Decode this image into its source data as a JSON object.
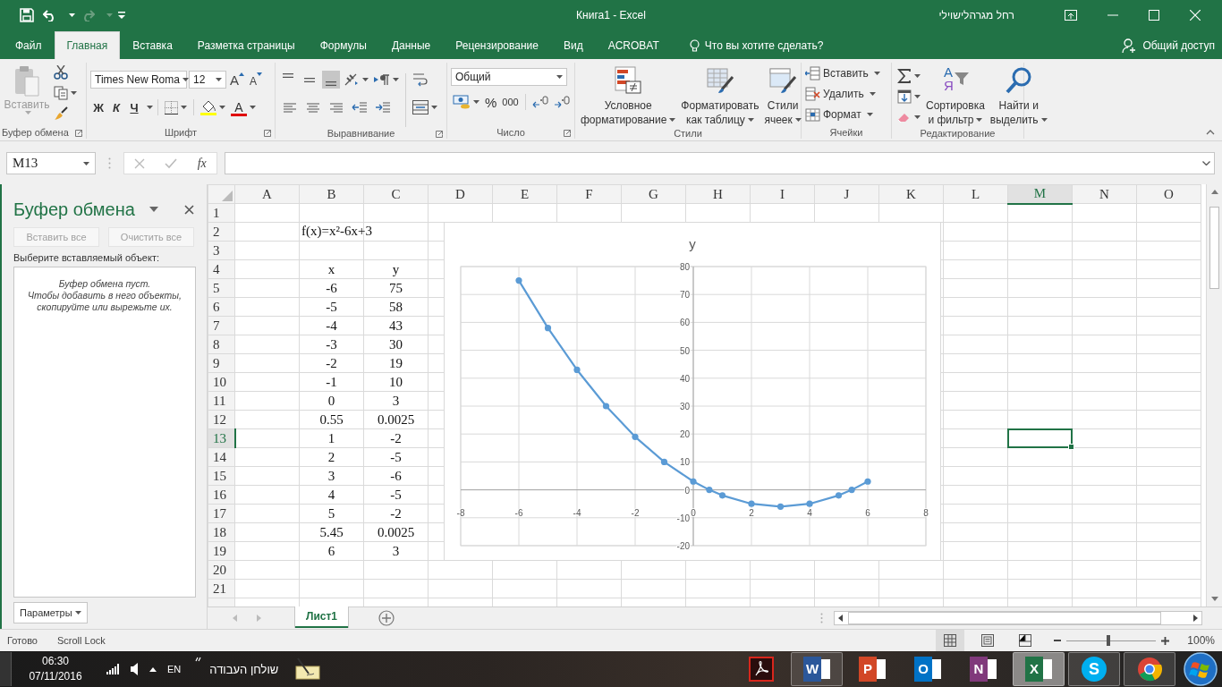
{
  "title_bar": {
    "document_title": "Книга1 - Excel",
    "user_name": "רחל מגרהלישוילי"
  },
  "ribbon_tabs": [
    {
      "label": "Файл",
      "selected": false
    },
    {
      "label": "Главная",
      "selected": true
    },
    {
      "label": "Вставка",
      "selected": false
    },
    {
      "label": "Разметка страницы",
      "selected": false
    },
    {
      "label": "Формулы",
      "selected": false
    },
    {
      "label": "Данные",
      "selected": false
    },
    {
      "label": "Рецензирование",
      "selected": false
    },
    {
      "label": "Вид",
      "selected": false
    },
    {
      "label": "ACROBAT",
      "selected": false
    }
  ],
  "tell_me": "Что вы хотите сделать?",
  "share": "Общий доступ",
  "ribbon": {
    "clipboard": {
      "label": "Буфер обмена",
      "paste": "Вставить",
      "paste_disabled": true
    },
    "font": {
      "label": "Шрифт",
      "font_name": "Times New Roma",
      "font_size": "12",
      "grow": "A",
      "shrink": "A",
      "bold": "Ж",
      "italic": "К",
      "underline": "Ч",
      "font_color": "A"
    },
    "alignment": {
      "label": "Выравнивание",
      "vertical_align": [
        {
          "selected": false
        },
        {
          "selected": false
        },
        {
          "selected": true
        }
      ]
    },
    "number": {
      "label": "Число",
      "format": "Общий",
      "percent": "%",
      "thousands": "000"
    },
    "styles": {
      "label": "Стили",
      "buttons": [
        {
          "kind": "conditional",
          "lines": [
            "Условное",
            "форматирование"
          ]
        },
        {
          "kind": "table",
          "lines": [
            "Форматировать",
            "как таблицу"
          ]
        },
        {
          "kind": "cell_styles",
          "lines": [
            "Стили",
            "ячеек"
          ]
        }
      ]
    },
    "cells": {
      "label": "Ячейки",
      "buttons": [
        {
          "kind": "insert",
          "label": "Вставить"
        },
        {
          "kind": "delete",
          "label": "Удалить"
        },
        {
          "kind": "format",
          "label": "Формат"
        }
      ]
    },
    "editing": {
      "label": "Редактирование",
      "sort_letters": [
        "А",
        "Я"
      ],
      "buttons": [
        {
          "kind": "sort",
          "lines": [
            "Сортировка",
            "и фильтр"
          ]
        },
        {
          "kind": "find",
          "lines": [
            "Найти и",
            "выделить"
          ]
        }
      ]
    }
  },
  "formula_bar": {
    "name_box": "M13",
    "function_label": "fx"
  },
  "clipboard_pane": {
    "title": "Буфер обмена",
    "buttons": [
      {
        "label": "Вставить все",
        "disabled": true
      },
      {
        "label": "Очистить все",
        "disabled": true
      }
    ],
    "prompt": "Выберите вставляемый объект:",
    "empty_message": [
      "Буфер обмена пуст.",
      "Чтобы добавить в него объекты,",
      "скопируйте или вырежьте их."
    ],
    "options": "Параметры"
  },
  "sheet": {
    "columns": [
      {
        "label": "A",
        "selected": false
      },
      {
        "label": "B",
        "selected": false
      },
      {
        "label": "C",
        "selected": false
      },
      {
        "label": "D",
        "selected": false
      },
      {
        "label": "E",
        "selected": false
      },
      {
        "label": "F",
        "selected": false
      },
      {
        "label": "G",
        "selected": false
      },
      {
        "label": "H",
        "selected": false
      },
      {
        "label": "I",
        "selected": false
      },
      {
        "label": "J",
        "selected": false
      },
      {
        "label": "K",
        "selected": false
      },
      {
        "label": "L",
        "selected": false
      },
      {
        "label": "M",
        "selected": true
      },
      {
        "label": "N",
        "selected": false
      },
      {
        "label": "O",
        "selected": false
      }
    ],
    "rows": [
      {
        "label": "1",
        "selected": false
      },
      {
        "label": "2",
        "selected": false,
        "kind": "formula",
        "cells": {
          "B": "f(x)=x²-6x+3"
        }
      },
      {
        "label": "3",
        "selected": false
      },
      {
        "label": "4",
        "selected": false,
        "kind": "data",
        "cells": {
          "B": "x",
          "C": "y"
        }
      },
      {
        "label": "5",
        "selected": false,
        "kind": "data",
        "cells": {
          "B": "-6",
          "C": "75"
        }
      },
      {
        "label": "6",
        "selected": false,
        "kind": "data",
        "cells": {
          "B": "-5",
          "C": "58"
        }
      },
      {
        "label": "7",
        "selected": false,
        "kind": "data",
        "cells": {
          "B": "-4",
          "C": "43"
        }
      },
      {
        "label": "8",
        "selected": false,
        "kind": "data",
        "cells": {
          "B": "-3",
          "C": "30"
        }
      },
      {
        "label": "9",
        "selected": false,
        "kind": "data",
        "cells": {
          "B": "-2",
          "C": "19"
        }
      },
      {
        "label": "10",
        "selected": false,
        "kind": "data",
        "cells": {
          "B": "-1",
          "C": "10"
        }
      },
      {
        "label": "11",
        "selected": false,
        "kind": "data",
        "cells": {
          "B": "0",
          "C": "3"
        }
      },
      {
        "label": "12",
        "selected": false,
        "kind": "data",
        "cells": {
          "B": "0.55",
          "C": "0.0025"
        }
      },
      {
        "label": "13",
        "selected": true,
        "kind": "data",
        "cells": {
          "B": "1",
          "C": "-2"
        }
      },
      {
        "label": "14",
        "selected": false,
        "kind": "data",
        "cells": {
          "B": "2",
          "C": "-5"
        }
      },
      {
        "label": "15",
        "selected": false,
        "kind": "data",
        "cells": {
          "B": "3",
          "C": "-6"
        }
      },
      {
        "label": "16",
        "selected": false,
        "kind": "data",
        "cells": {
          "B": "4",
          "C": "-5"
        }
      },
      {
        "label": "17",
        "selected": false,
        "kind": "data",
        "cells": {
          "B": "5",
          "C": "-2"
        }
      },
      {
        "label": "18",
        "selected": false,
        "kind": "data",
        "cells": {
          "B": "5.45",
          "C": "0.0025"
        }
      },
      {
        "label": "19",
        "selected": false,
        "kind": "data",
        "cells": {
          "B": "6",
          "C": "3"
        }
      },
      {
        "label": "20",
        "selected": false
      },
      {
        "label": "21",
        "selected": false
      }
    ]
  },
  "chart": {
    "chart_data": {
      "type": "line",
      "grid": true,
      "xlim": [
        -8,
        8
      ],
      "ylim": [
        -20,
        80
      ],
      "xticks": [
        -8,
        -6,
        -4,
        -2,
        0,
        2,
        4,
        6,
        8
      ],
      "yticks": [
        -20,
        -10,
        0,
        10,
        20,
        30,
        40,
        50,
        60,
        70,
        80
      ],
      "x": [
        -6,
        -5,
        -4,
        -3,
        -2,
        -1,
        0,
        0.55,
        1,
        2,
        3,
        4,
        5,
        5.45,
        6
      ],
      "series": [
        {
          "name": "y",
          "color": "#5b9bd5",
          "marker": true,
          "values": [
            75,
            58,
            43,
            30,
            19,
            10,
            3,
            0,
            -2,
            -5,
            -6,
            -5,
            -2,
            0,
            3
          ]
        }
      ]
    }
  },
  "sheet_tabs": [
    {
      "label": "Лист1",
      "selected": true
    }
  ],
  "status_bar": {
    "items": [
      "Готово",
      "Scroll Lock"
    ],
    "views": [
      {
        "kind": "normal",
        "selected": true
      },
      {
        "kind": "page_layout",
        "selected": false
      },
      {
        "kind": "page_break",
        "selected": false
      }
    ],
    "zoom": {
      "level": 0.47,
      "reading": "100%"
    }
  },
  "taskbar": {
    "time": "06:30",
    "date": "07/11/2016",
    "language": "EN",
    "toolbar_label": "שולחן העבודה",
    "apps": [
      {
        "kind": "acrobat",
        "open": false,
        "selected": false
      },
      {
        "kind": "word",
        "letter": "W",
        "open": true,
        "selected": false
      },
      {
        "kind": "powerpoint",
        "letter": "P",
        "open": false,
        "selected": false
      },
      {
        "kind": "outlook",
        "letter": "O",
        "open": false,
        "selected": false
      },
      {
        "kind": "onenote",
        "letter": "N",
        "open": false,
        "selected": false
      },
      {
        "kind": "excel",
        "letter": "X",
        "open": true,
        "selected": true
      },
      {
        "kind": "skype",
        "letter": "S",
        "open": true,
        "selected": false
      },
      {
        "kind": "chrome",
        "open": true,
        "selected": false
      }
    ]
  }
}
